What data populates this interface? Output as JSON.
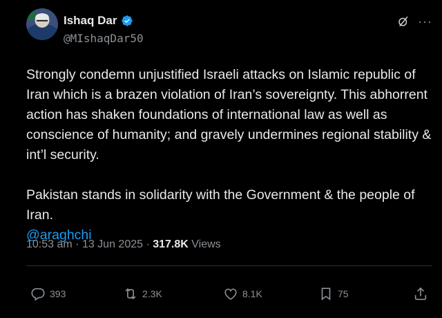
{
  "author": {
    "name": "Ishaq Dar",
    "handle": "@MIshaqDar50"
  },
  "top_icons": [
    "grok-icon",
    "more-icon"
  ],
  "more_label": "···",
  "body": {
    "paragraph1": "Strongly condemn unjustified Israeli attacks on Islamic republic of Iran which is a brazen violation of Iran’s sovereignty. This abhorrent action has shaken foundations of international law as well as conscience of humanity; and gravely undermines regional stability & int’l security.",
    "paragraph2": "Pakistan stands in solidarity with the Government & the people of Iran.",
    "mention": "@araghchi"
  },
  "meta": {
    "time": "10:53 am",
    "separator1": " · ",
    "date": "13 Jun 2025",
    "separator2": " · ",
    "views_count": "317.8K",
    "views_label": " Views"
  },
  "actions": {
    "replies": "393",
    "reposts": "2.3K",
    "likes": "8.1K",
    "bookmarks": "75"
  },
  "colors": {
    "background": "#000000",
    "text": "#e7e9ea",
    "secondary": "#8b9196",
    "link": "#1d9bf0",
    "verified": "#1d9bf0"
  }
}
